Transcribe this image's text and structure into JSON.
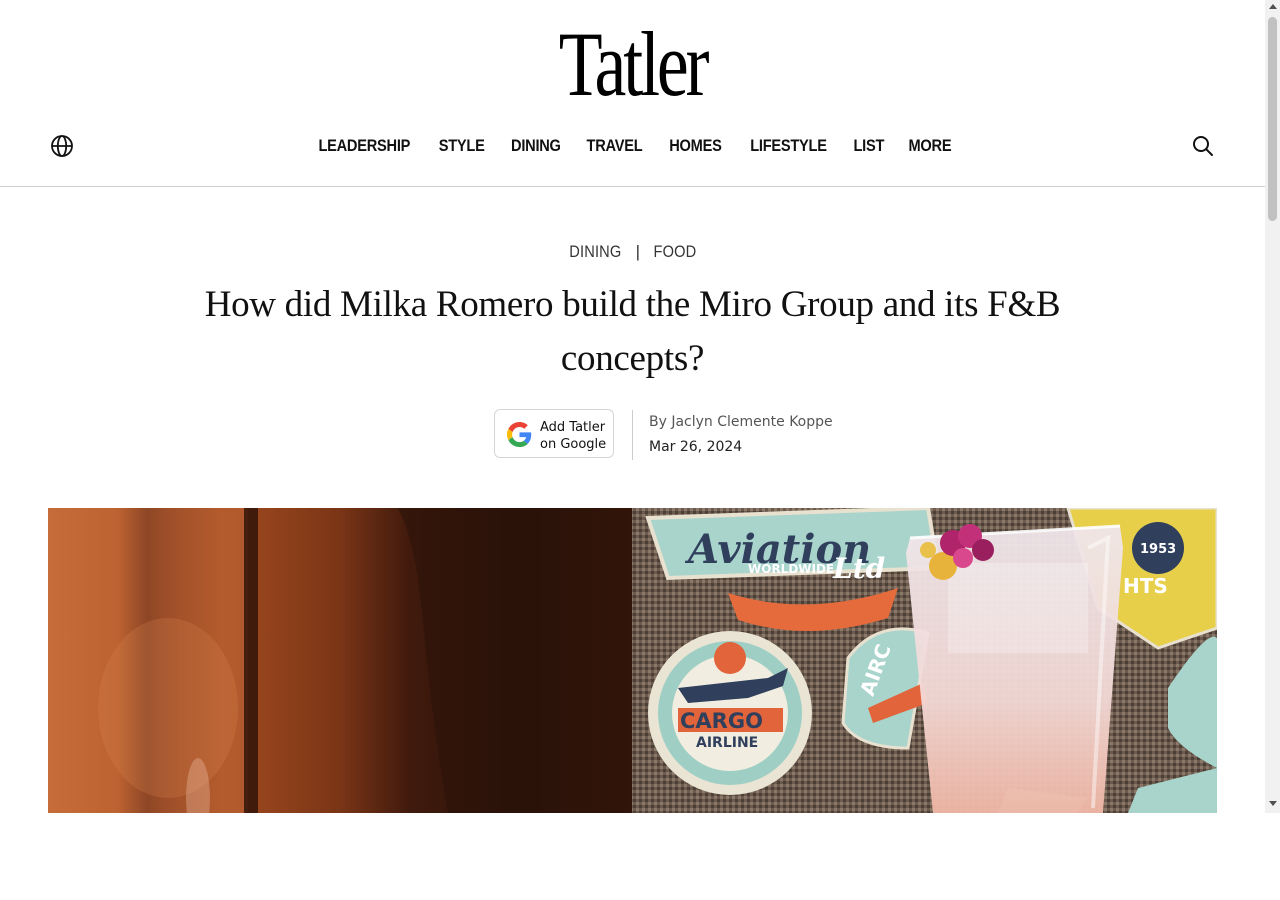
{
  "header": {
    "logo": "Tatler",
    "globe_icon": "globe-icon",
    "search_icon": "search-icon",
    "nav": [
      "LEADERSHIP",
      "STYLE",
      "DINING",
      "TRAVEL",
      "HOMES",
      "LIFESTYLE",
      "LIST",
      "MORE"
    ]
  },
  "article": {
    "categories": [
      "DINING",
      "FOOD"
    ],
    "separator": "|",
    "headline": "How did Milka Romero build the Miro Group and its F&B concepts?",
    "google_button": {
      "line1": "Add Tatler",
      "line2": "on Google"
    },
    "byline_prefix": "By",
    "author": "Jaclyn Clemente Koppe",
    "date": "Mar 26, 2024"
  },
  "hero_image": {
    "badge_text": [
      "Aviation",
      "WORLDWIDE",
      "Ltd",
      "CARGO",
      "AIRLINE",
      "1953",
      "HTS",
      "AIRC"
    ]
  },
  "colors": {
    "text": "#111111",
    "muted": "#555555",
    "rule": "#cfcfcf",
    "leather": "#b0592a"
  }
}
